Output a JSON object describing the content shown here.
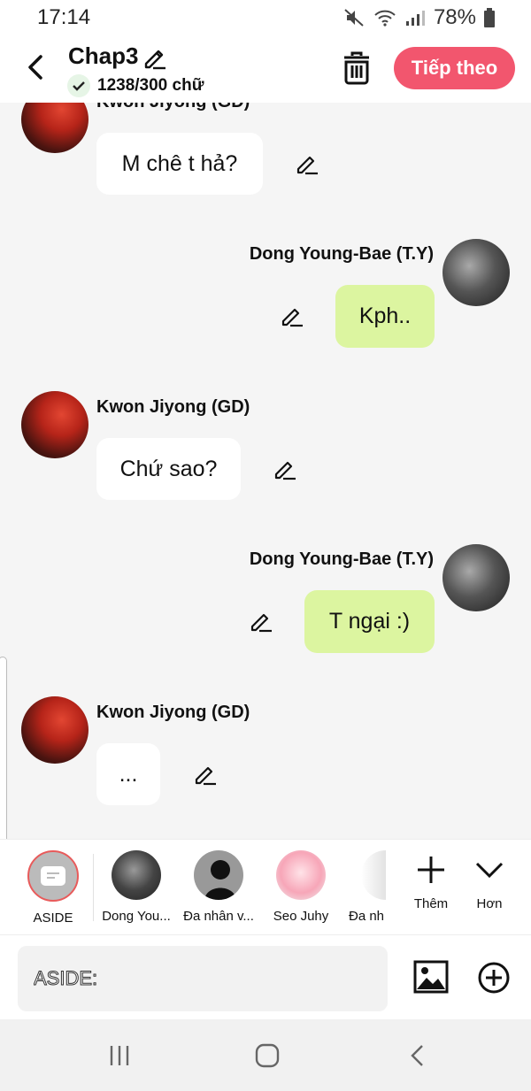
{
  "status_bar": {
    "time": "17:14",
    "battery": "78%"
  },
  "header": {
    "title": "Chap3",
    "word_count": "1238/300 chữ",
    "next_label": "Tiếp theo",
    "accent_color": "#f2566e"
  },
  "messages": [
    {
      "sender": "Kwon Jiyong (GD)",
      "text": "M chê t hả?",
      "side": "left"
    },
    {
      "sender": "Dong Young-Bae (T.Y)",
      "text": "Kph..",
      "side": "right"
    },
    {
      "sender": "Kwon Jiyong (GD)",
      "text": "Chứ sao?",
      "side": "left"
    },
    {
      "sender": "Dong Young-Bae (T.Y)",
      "text": "T ngại :)",
      "side": "right"
    },
    {
      "sender": "Kwon Jiyong (GD)",
      "text": "...",
      "side": "left"
    }
  ],
  "characters": [
    {
      "label": "ASIDE"
    },
    {
      "label": "Dong You..."
    },
    {
      "label": "Đa nhân v..."
    },
    {
      "label": "Seo Juhy"
    },
    {
      "label": "Đa nh"
    }
  ],
  "tools": {
    "add_label": "Thêm",
    "more_label": "Hơn"
  },
  "input": {
    "placeholder": "ASIDE:"
  }
}
